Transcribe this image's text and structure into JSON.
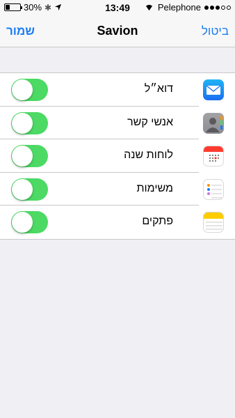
{
  "status_bar": {
    "battery": "30%",
    "battery_level": 0.3,
    "time": "13:49",
    "carrier": "Pelephone",
    "bluetooth_icon": "bluetooth-icon",
    "location_icon": "location-arrow-icon",
    "wifi_icon": "wifi-icon"
  },
  "navbar": {
    "left_label": "שמור",
    "title": "Savion",
    "right_label": "ביטול"
  },
  "colors": {
    "accent": "#1a7cf5",
    "toggle_on": "#4cd964",
    "background": "#efeff4"
  },
  "rows": [
    {
      "label": "דוא״ל",
      "icon": "mail-icon",
      "enabled": true
    },
    {
      "label": "אנשי קשר",
      "icon": "contacts-icon",
      "enabled": true
    },
    {
      "label": "לוחות שנה",
      "icon": "calendar-icon",
      "enabled": true
    },
    {
      "label": "משימות",
      "icon": "reminders-icon",
      "enabled": true
    },
    {
      "label": "פתקים",
      "icon": "notes-icon",
      "enabled": true
    }
  ]
}
